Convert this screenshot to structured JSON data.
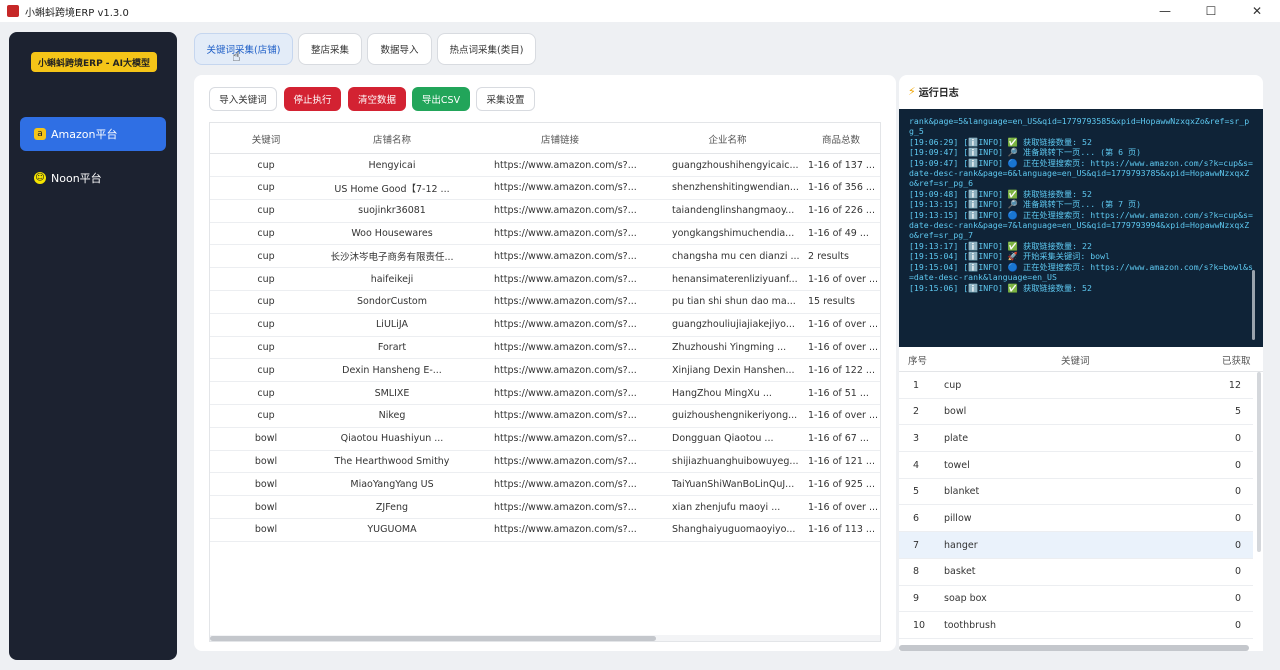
{
  "window": {
    "title": "小蝌蚪跨境ERP v1.3.0",
    "controls": {
      "minimize": "—",
      "maximize": "☐",
      "close": "✕"
    }
  },
  "sidebar": {
    "logo": "小蝌蚪跨境ERP - AI大模型",
    "items": [
      {
        "label": "Amazon平台",
        "icon": "amazon-icon",
        "active": true
      },
      {
        "label": "Noon平台",
        "icon": "noon-smile-icon",
        "active": false
      }
    ]
  },
  "tabs": [
    {
      "label": "关键词采集(店铺)",
      "active": true
    },
    {
      "label": "整店采集",
      "active": false
    },
    {
      "label": "数据导入",
      "active": false
    },
    {
      "label": "热点词采集(类目)",
      "active": false
    }
  ],
  "toolbar": {
    "import": "导入关键词",
    "stop": "停止执行",
    "clear": "清空数据",
    "export": "导出CSV",
    "settings": "采集设置"
  },
  "table": {
    "columns": [
      "关键词",
      "店铺名称",
      "店铺链接",
      "企业名称",
      "商品总数"
    ],
    "rows": [
      [
        "cup",
        "Hengyicai",
        "https://www.amazon.com/s?...",
        "guangzhoushihengyicaic...",
        "1-16 of 137 ..."
      ],
      [
        "cup",
        "US Home Good【7-12 ...",
        "https://www.amazon.com/s?...",
        "shenzhenshitingwendian...",
        "1-16 of 356 ..."
      ],
      [
        "cup",
        "suojinkr36081",
        "https://www.amazon.com/s?...",
        "taiandenglinshangmaoy...",
        "1-16 of 226 ..."
      ],
      [
        "cup",
        "Woo Housewares",
        "https://www.amazon.com/s?...",
        "yongkangshimuchendia...",
        "1-16 of 49 ..."
      ],
      [
        "cup",
        "长沙沐岑电子商务有限责任...",
        "https://www.amazon.com/s?...",
        "changsha mu cen dianzi ...",
        "2 results"
      ],
      [
        "cup",
        "haifeikeji",
        "https://www.amazon.com/s?...",
        "henansimaterenliziyuanf...",
        "1-16 of over ..."
      ],
      [
        "cup",
        "SondorCustom",
        "https://www.amazon.com/s?...",
        "pu tian shi shun dao ma...",
        "15 results"
      ],
      [
        "cup",
        "LiULiJA",
        "https://www.amazon.com/s?...",
        "guangzhouliujiajiakejiyo...",
        "1-16 of over ..."
      ],
      [
        "cup",
        "Forart",
        "https://www.amazon.com/s?...",
        "Zhuzhoushi Yingming ...",
        "1-16 of over ..."
      ],
      [
        "cup",
        "Dexin Hansheng E-...",
        "https://www.amazon.com/s?...",
        "Xinjiang Dexin Hanshen...",
        "1-16 of 122 ..."
      ],
      [
        "cup",
        "SMLIXE",
        "https://www.amazon.com/s?...",
        "HangZhou MingXu ...",
        "1-16 of 51 ..."
      ],
      [
        "cup",
        "Nikeg",
        "https://www.amazon.com/s?...",
        "guizhoushengnikeriyong...",
        "1-16 of over ..."
      ],
      [
        "bowl",
        "Qiaotou Huashiyun ...",
        "https://www.amazon.com/s?...",
        "Dongguan Qiaotou ...",
        "1-16 of 67 ..."
      ],
      [
        "bowl",
        "The Hearthwood Smithy",
        "https://www.amazon.com/s?...",
        "shijiazhuanghuibowuyeg...",
        "1-16 of 121 ..."
      ],
      [
        "bowl",
        "MiaoYangYang US",
        "https://www.amazon.com/s?...",
        "TaiYuanShiWanBoLinQuJ...",
        "1-16 of 925 ..."
      ],
      [
        "bowl",
        "ZJFeng",
        "https://www.amazon.com/s?...",
        "xian zhenjufu maoyi ...",
        "1-16 of over ..."
      ],
      [
        "bowl",
        "YUGUOMA",
        "https://www.amazon.com/s?...",
        "Shanghaiyuguomaoyiyo...",
        "1-16 of 113 ..."
      ]
    ]
  },
  "log": {
    "title": "运行日志",
    "lines": [
      "rank&page=5&language=en_US&qid=1779793585&xpid=HopawwNzxqxZo&ref=sr_pg_5",
      "[19:06:29] [ℹ️INFO] ✅ 获取链接数量: 52",
      "[19:09:47] [ℹ️INFO] 🔎 准备跳转下一页... (第 6 页)",
      "[19:09:47] [ℹ️INFO] 🔵 正在处理搜索页: https://www.amazon.com/s?k=cup&s=date-desc-rank&page=6&language=en_US&qid=1779793785&xpid=HopawwNzxqxZo&ref=sr_pg_6",
      "[19:09:48] [ℹ️INFO] ✅ 获取链接数量: 52",
      "[19:13:15] [ℹ️INFO] 🔎 准备跳转下一页... (第 7 页)",
      "[19:13:15] [ℹ️INFO] 🔵 正在处理搜索页: https://www.amazon.com/s?k=cup&s=date-desc-rank&page=7&language=en_US&qid=1779793994&xpid=HopawwNzxqxZo&ref=sr_pg_7",
      "[19:13:17] [ℹ️INFO] ✅ 获取链接数量: 22",
      "[19:15:04] [ℹ️INFO] 🚀 开始采集关键词: bowl",
      "[19:15:04] [ℹ️INFO] 🔵 正在处理搜索页: https://www.amazon.com/s?k=bowl&s=date-desc-rank&language=en_US",
      "[19:15:06] [ℹ️INFO] ✅ 获取链接数量: 52"
    ]
  },
  "keywords": {
    "columns": [
      "序号",
      "关键词",
      "已获取"
    ],
    "rows": [
      [
        "1",
        "cup",
        "12"
      ],
      [
        "2",
        "bowl",
        "5"
      ],
      [
        "3",
        "plate",
        "0"
      ],
      [
        "4",
        "towel",
        "0"
      ],
      [
        "5",
        "blanket",
        "0"
      ],
      [
        "6",
        "pillow",
        "0"
      ],
      [
        "7",
        "hanger",
        "0"
      ],
      [
        "8",
        "basket",
        "0"
      ],
      [
        "9",
        "soap box",
        "0"
      ],
      [
        "10",
        "toothbrush",
        "0"
      ]
    ],
    "selected_index": 6
  }
}
